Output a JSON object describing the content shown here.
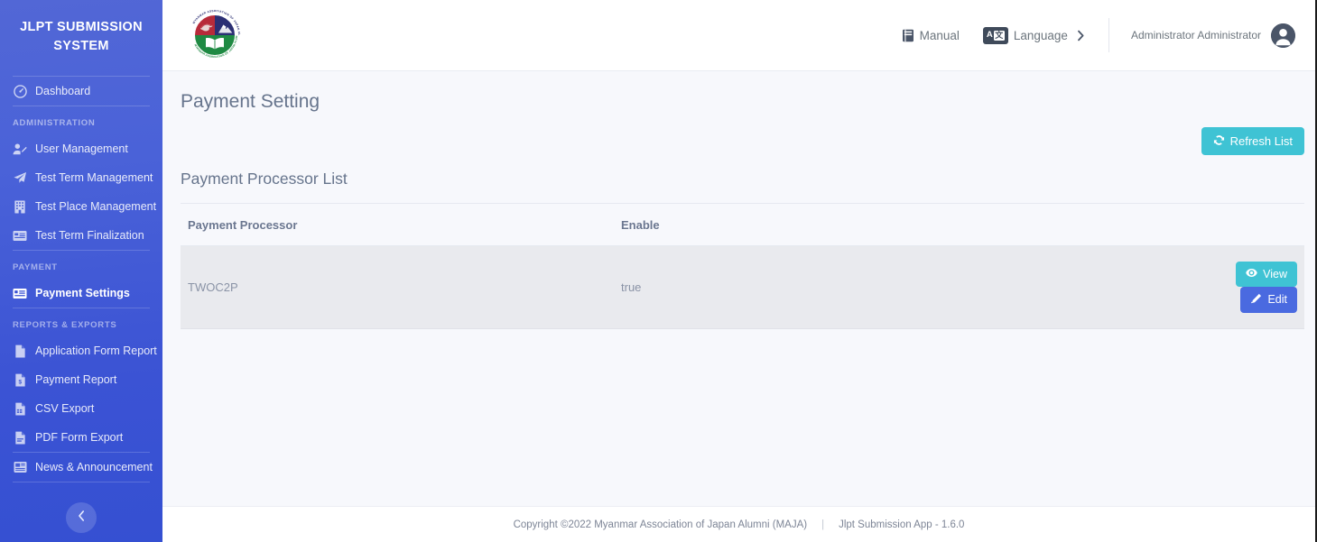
{
  "sidebar": {
    "brand_title": "JLPT SUBMISSION SYSTEM",
    "items": [
      {
        "label": "Dashboard",
        "icon": "dashboard-icon",
        "name": "sidebar-item-dashboard",
        "active": false
      },
      {
        "label": "User Management",
        "icon": "user-edit-icon",
        "name": "sidebar-item-user-management",
        "active": false
      },
      {
        "label": "Test Term Management",
        "icon": "paper-plane-icon",
        "name": "sidebar-item-test-term-management",
        "active": false
      },
      {
        "label": "Test Place Management",
        "icon": "building-icon",
        "name": "sidebar-item-test-place-management",
        "active": false
      },
      {
        "label": "Test Term Finalization",
        "icon": "id-card-icon",
        "name": "sidebar-item-test-term-finalization",
        "active": false
      },
      {
        "label": "Payment Settings",
        "icon": "payment-card-icon",
        "name": "sidebar-item-payment-settings",
        "active": true
      },
      {
        "label": "Application Form Report",
        "icon": "document-icon",
        "name": "sidebar-item-application-form-report",
        "active": false
      },
      {
        "label": "Payment Report",
        "icon": "document-dollar-icon",
        "name": "sidebar-item-payment-report",
        "active": false
      },
      {
        "label": "CSV Export",
        "icon": "document-csv-icon",
        "name": "sidebar-item-csv-export",
        "active": false
      },
      {
        "label": "PDF Form Export",
        "icon": "document-pdf-icon",
        "name": "sidebar-item-pdf-form-export",
        "active": false
      },
      {
        "label": "News & Announcement",
        "icon": "news-icon",
        "name": "sidebar-item-news-announcement",
        "active": false
      }
    ],
    "group_administration": "ADMINISTRATION",
    "group_payment": "PAYMENT",
    "group_reports": "REPORTS & EXPORTS",
    "collapse_icon": "chevron-left-icon"
  },
  "topbar": {
    "logo": "maja-logo",
    "manual_label": "Manual",
    "manual_icon": "book-icon",
    "language_label": "Language",
    "language_icon": "translate-icon",
    "language_badge_a": "A",
    "language_badge_b": "文",
    "chevron_icon": "chevron-right-icon",
    "user_name": "Administrator Administrator",
    "avatar_icon": "user-avatar-icon"
  },
  "content": {
    "page_title": "Payment Setting",
    "refresh_label": "Refresh List",
    "refresh_icon": "refresh-icon",
    "section_title": "Payment Processor List",
    "table": {
      "columns": [
        "Payment Processor",
        "Enable"
      ],
      "rows": [
        {
          "payment_processor": "TWOC2P",
          "enable": "true",
          "view_label": "View",
          "view_icon": "eye-icon",
          "edit_label": "Edit",
          "edit_icon": "pencil-icon"
        }
      ]
    }
  },
  "footer": {
    "copyright": "Copyright ©2022 Myanmar Association of Japan Alumni (MAJA)",
    "separator": "|",
    "app_version": "Jlpt Submission App - 1.6.0"
  },
  "colors": {
    "sidebar_top": "#5267d6",
    "sidebar_bottom": "#3550d2",
    "teal": "#3fc3d4",
    "blue": "#4a6ae0",
    "content_bg": "#f7f8fc",
    "row_bg": "#e9eaee"
  }
}
